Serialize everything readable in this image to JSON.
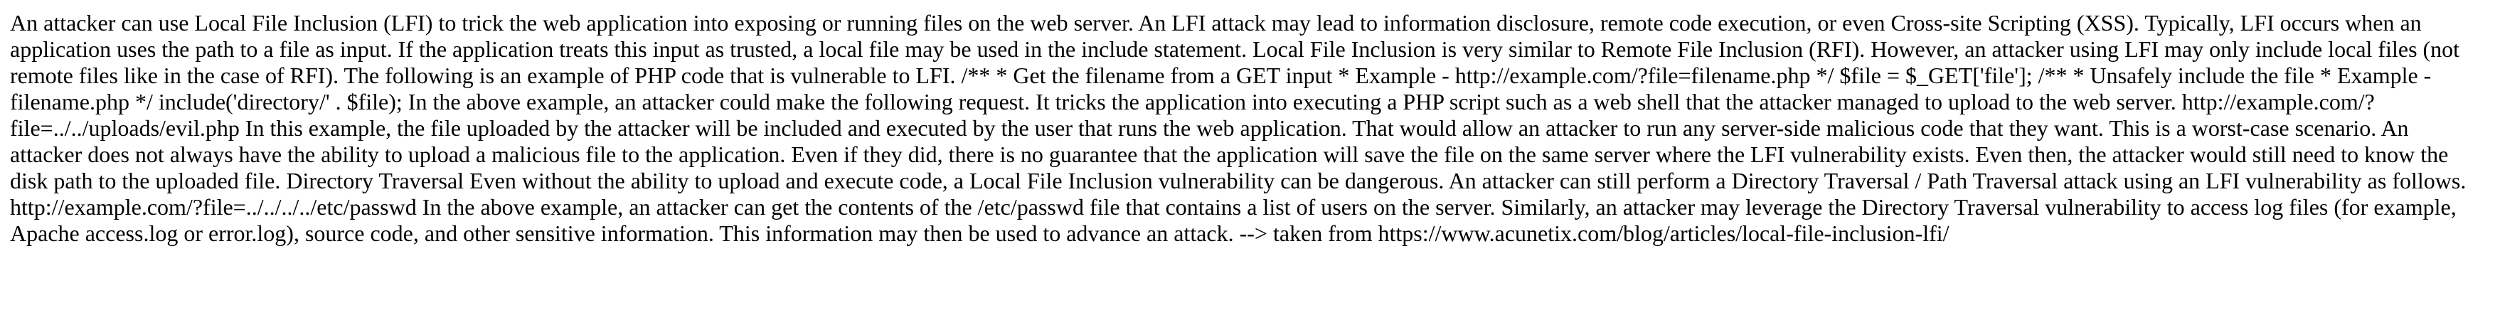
{
  "document": {
    "body_text": "An attacker can use Local File Inclusion (LFI) to trick the web application into exposing or running files on the web server. An LFI attack may lead to information disclosure, remote code execution, or even Cross-site Scripting (XSS). Typically, LFI occurs when an application uses the path to a file as input. If the application treats this input as trusted, a local file may be used in the include statement. Local File Inclusion is very similar to Remote File Inclusion (RFI). However, an attacker using LFI may only include local files (not remote files like in the case of RFI). The following is an example of PHP code that is vulnerable to LFI. /** * Get the filename from a GET input * Example - http://example.com/?file=filename.php */ $file = $_GET['file']; /** * Unsafely include the file * Example - filename.php */ include('directory/' . $file); In the above example, an attacker could make the following request. It tricks the application into executing a PHP script such as a web shell that the attacker managed to upload to the web server. http://example.com/?file=../../uploads/evil.php In this example, the file uploaded by the attacker will be included and executed by the user that runs the web application. That would allow an attacker to run any server-side malicious code that they want. This is a worst-case scenario. An attacker does not always have the ability to upload a malicious file to the application. Even if they did, there is no guarantee that the application will save the file on the same server where the LFI vulnerability exists. Even then, the attacker would still need to know the disk path to the uploaded file. Directory Traversal Even without the ability to upload and execute code, a Local File Inclusion vulnerability can be dangerous. An attacker can still perform a Directory Traversal / Path Traversal attack using an LFI vulnerability as follows. http://example.com/?file=../../../../etc/passwd In the above example, an attacker can get the contents of the /etc/passwd file that contains a list of users on the server. Similarly, an attacker may leverage the Directory Traversal vulnerability to access log files (for example, Apache access.log or error.log), source code, and other sensitive information. This information may then be used to advance an attack. --> taken from https://www.acunetix.com/blog/articles/local-file-inclusion-lfi/"
  }
}
